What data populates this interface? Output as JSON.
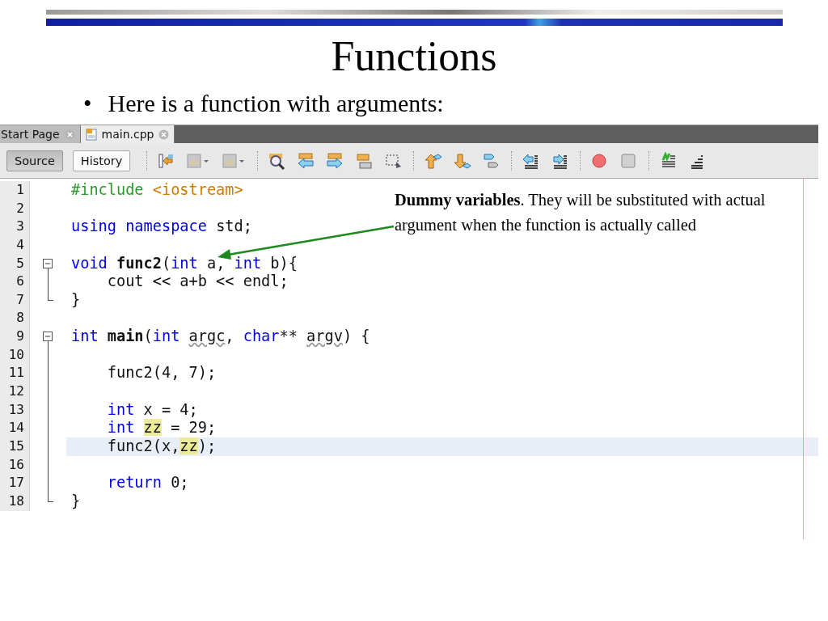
{
  "slide": {
    "title": "Functions",
    "bullet_mark": "•",
    "bullet": "Here is a function with arguments:"
  },
  "ide": {
    "tabs": [
      {
        "label": "Start Page",
        "selected": false
      },
      {
        "label": "main.cpp",
        "selected": true
      }
    ],
    "view_buttons": [
      {
        "label": "Source",
        "selected": true
      },
      {
        "label": "History",
        "selected": false
      }
    ],
    "editor": {
      "lines": [
        {
          "number": "1",
          "current": false,
          "kind": "plain",
          "tokens": [
            {
              "kind": "preproc",
              "text": "#include "
            },
            {
              "kind": "path",
              "text": "<iostream>"
            }
          ]
        },
        {
          "number": "2",
          "current": false,
          "kind": "plain"
        },
        {
          "number": "3",
          "current": false,
          "kind": "plain",
          "tokens": [
            {
              "kind": "keyword",
              "text": "using "
            },
            {
              "kind": "keyword",
              "text": "namespace "
            },
            {
              "kind": "plain",
              "text": "std;"
            }
          ]
        },
        {
          "number": "4",
          "current": false,
          "kind": "plain"
        },
        {
          "number": "5",
          "current": false,
          "kind": "opener",
          "tokens": [
            {
              "kind": "keyword",
              "text": "void "
            },
            {
              "kind": "bold",
              "text": "func2"
            },
            {
              "kind": "plain",
              "text": "("
            },
            {
              "kind": "keyword",
              "text": "int "
            },
            {
              "kind": "plain",
              "text": "a, "
            },
            {
              "kind": "keyword",
              "text": "int "
            },
            {
              "kind": "plain",
              "text": "b){"
            }
          ]
        },
        {
          "number": "6",
          "current": false,
          "kind": "inner",
          "tokens": [
            {
              "kind": "plain",
              "text": "    cout << a+b << endl;"
            }
          ]
        },
        {
          "number": "7",
          "current": false,
          "kind": "closer",
          "tokens": [
            {
              "kind": "plain",
              "text": "}"
            }
          ]
        },
        {
          "number": "8",
          "current": false,
          "kind": "plain"
        },
        {
          "number": "9",
          "current": false,
          "kind": "opener",
          "tokens": [
            {
              "kind": "keyword",
              "text": "int "
            },
            {
              "kind": "bold",
              "text": "main"
            },
            {
              "kind": "plain",
              "text": "("
            },
            {
              "kind": "keyword",
              "text": "int "
            },
            {
              "kind": "unused",
              "text": "argc"
            },
            {
              "kind": "plain",
              "text": ", "
            },
            {
              "kind": "keyword",
              "text": "char"
            },
            {
              "kind": "plain",
              "text": "** "
            },
            {
              "kind": "unused",
              "text": "argv"
            },
            {
              "kind": "plain",
              "text": ") {"
            }
          ]
        },
        {
          "number": "10",
          "current": false,
          "kind": "inner"
        },
        {
          "number": "11",
          "current": false,
          "kind": "inner",
          "tokens": [
            {
              "kind": "plain",
              "text": "    func2(4, 7);"
            }
          ]
        },
        {
          "number": "12",
          "current": false,
          "kind": "inner"
        },
        {
          "number": "13",
          "current": false,
          "kind": "inner",
          "tokens": [
            {
              "kind": "keyword",
              "text": "    int"
            },
            {
              "kind": "plain",
              "text": " x = 4;"
            }
          ]
        },
        {
          "number": "14",
          "current": false,
          "kind": "inner",
          "tokens": [
            {
              "kind": "keyword",
              "text": "    int "
            },
            {
              "kind": "mark",
              "text": "zz"
            },
            {
              "kind": "plain",
              "text": " = 29;"
            }
          ]
        },
        {
          "number": "15",
          "current": true,
          "kind": "inner",
          "tokens": [
            {
              "kind": "plain",
              "text": "    func2(x,"
            },
            {
              "kind": "mark",
              "text": "zz"
            },
            {
              "kind": "plain",
              "text": ");"
            }
          ]
        },
        {
          "number": "16",
          "current": false,
          "kind": "inner"
        },
        {
          "number": "17",
          "current": false,
          "kind": "inner",
          "tokens": [
            {
              "kind": "keyword",
              "text": "    return"
            },
            {
              "kind": "plain",
              "text": " 0;"
            }
          ]
        },
        {
          "number": "18",
          "current": false,
          "kind": "closer",
          "tokens": [
            {
              "kind": "plain",
              "text": "}"
            }
          ]
        }
      ]
    }
  },
  "annotation": {
    "text": "**Dummy variables**. They will be substituted with actual argument when the function is actually called"
  }
}
